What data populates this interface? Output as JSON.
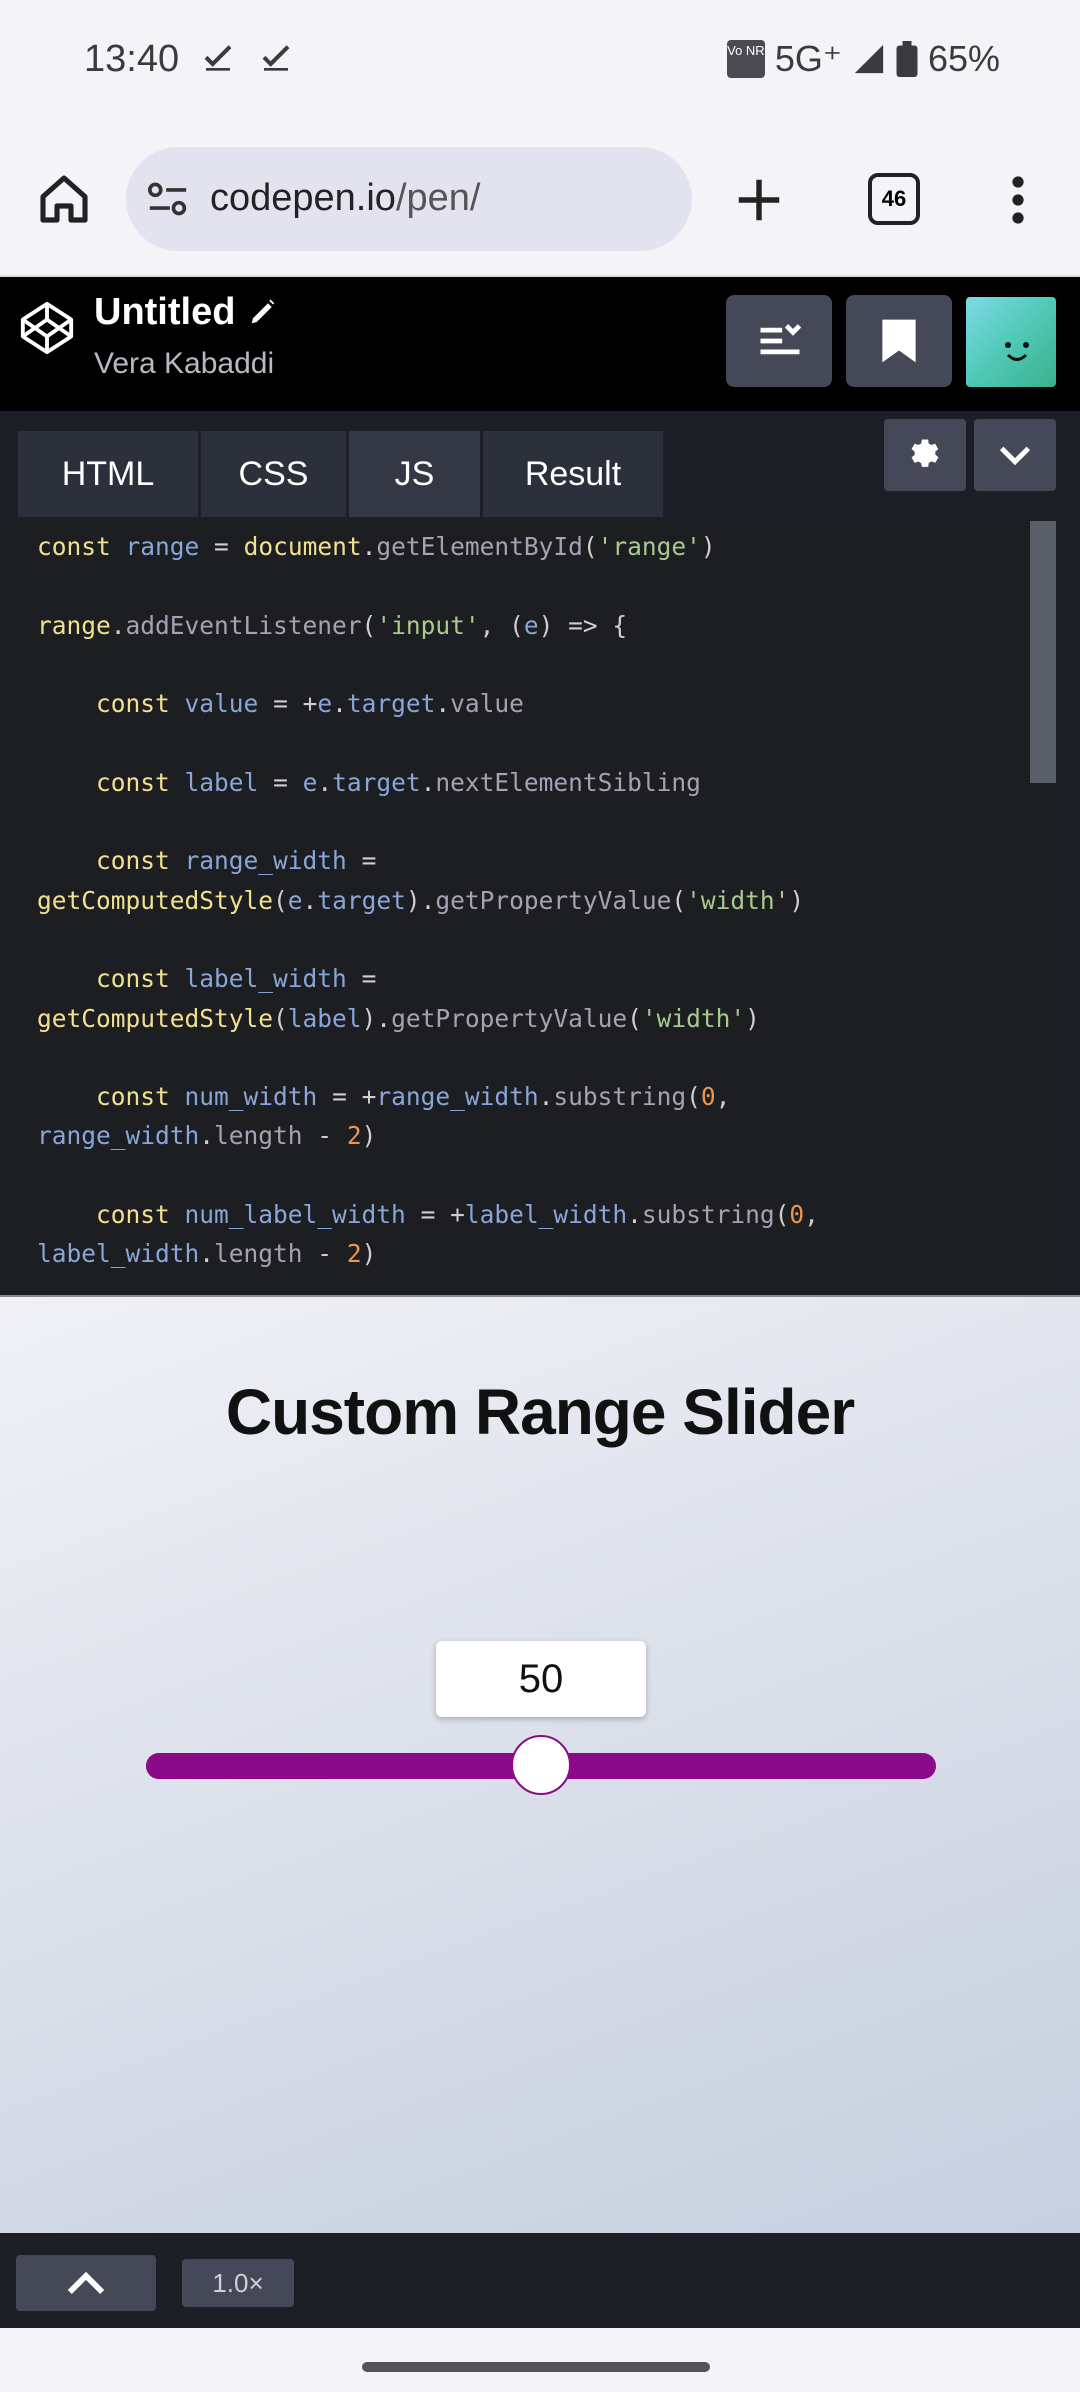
{
  "status_bar": {
    "time": "13:40",
    "network": "5G⁺",
    "battery": "65%",
    "vonr_badge": "Vo NR"
  },
  "browser": {
    "url_domain": "codepen.io",
    "url_path": "/pen/",
    "tab_count": "46"
  },
  "codepen": {
    "title": "Untitled",
    "author": "Vera Kabaddi",
    "tabs": [
      "HTML",
      "CSS",
      "JS",
      "Result"
    ],
    "active_tab": "JS"
  },
  "result": {
    "heading": "Custom Range Slider",
    "slider_value": "50",
    "slider_fraction": 0.5
  },
  "bottom_bar": {
    "zoom": "1.0×"
  },
  "colors": {
    "slider": "#8a0a8a",
    "editor_bg": "#1d1e22",
    "header_bg": "#000000"
  },
  "icons": [
    "home-icon",
    "site-info-icon",
    "new-tab-icon",
    "more-icon",
    "codepen-logo-icon",
    "pencil-icon",
    "layout-icon",
    "bookmark-icon",
    "gear-icon",
    "chevron-down-icon",
    "chevron-up-icon"
  ]
}
